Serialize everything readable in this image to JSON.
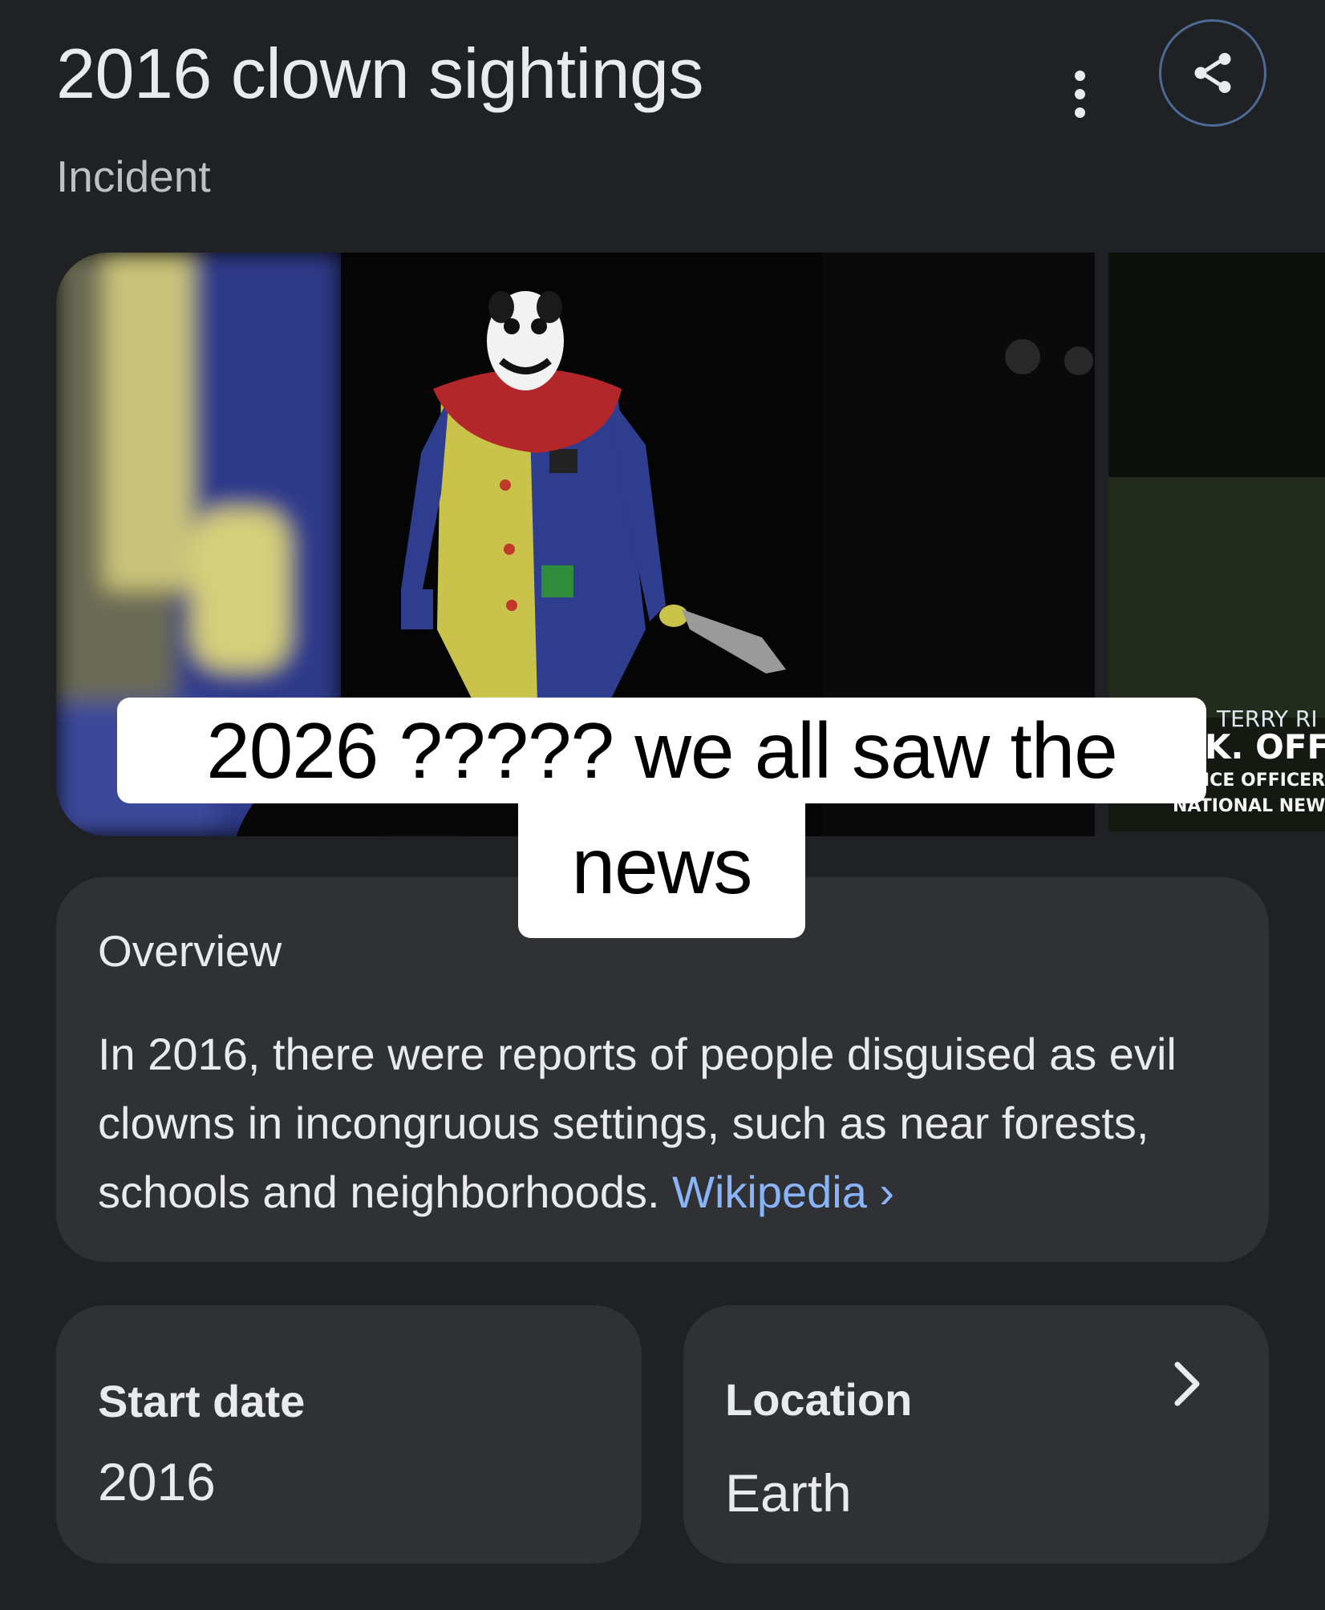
{
  "header": {
    "title": "2016 clown sightings",
    "subtitle": "Incident"
  },
  "icons": {
    "more": "more-vert-icon",
    "share": "share-icon"
  },
  "carousel": {
    "secondary_chyron": {
      "line1": "TERRY RI",
      "line2": "K. OFFIC",
      "line3": "ICE OFFICER I",
      "line4": "NATIONAL NEWS:"
    }
  },
  "caption_overlay": {
    "line1": "2026 ????? we all saw the",
    "line2": "news"
  },
  "overview": {
    "heading": "Overview",
    "text": "In 2016, there were reports of people disguised as evil clowns in incongruous settings, such as near forests, schools and neighborhoods.",
    "source_link": "Wikipedia",
    "source_chevron": "›"
  },
  "facts": {
    "start_date": {
      "label": "Start date",
      "value": "2016"
    },
    "location": {
      "label": "Location",
      "value": "Earth"
    }
  },
  "colors": {
    "background": "#202124",
    "card": "#303134",
    "text": "#e8eaed",
    "muted_text": "#bdc1c6",
    "link": "#8ab4f8",
    "share_ring": "#4d6a95"
  }
}
